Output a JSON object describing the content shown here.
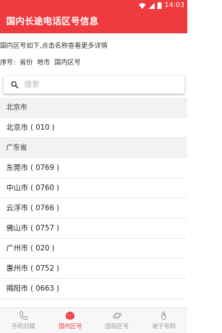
{
  "status": {
    "time": "14:03"
  },
  "appbar": {
    "title": "国内长途电话区号信息"
  },
  "intro": "国内区号如下,点击名称查看更多详情",
  "columns": [
    "序号:",
    "省份",
    "地市",
    "国内区号"
  ],
  "search": {
    "placeholder": "搜索"
  },
  "list": [
    {
      "type": "section",
      "label": "北京市"
    },
    {
      "type": "row",
      "label": "北京市 ( 010 )"
    },
    {
      "type": "section",
      "label": "广东省"
    },
    {
      "type": "row",
      "label": "东莞市 ( 0769 )"
    },
    {
      "type": "row",
      "label": "中山市 ( 0760 )"
    },
    {
      "type": "row",
      "label": "云浮市 ( 0766 )"
    },
    {
      "type": "row",
      "label": "佛山市 ( 0757 )"
    },
    {
      "type": "row",
      "label": "广州市 ( 020 )"
    },
    {
      "type": "row",
      "label": "惠州市 ( 0752 )"
    },
    {
      "type": "row",
      "label": "揭阳市 ( 0663 )"
    }
  ],
  "bottom_nav": [
    {
      "label": "手机归属",
      "icon": "phone-icon",
      "active": false
    },
    {
      "label": "国内区号",
      "icon": "cube-icon",
      "active": true
    },
    {
      "label": "国际区号",
      "icon": "planet-icon",
      "active": false
    },
    {
      "label": "谢子号码",
      "icon": "flame-icon",
      "active": false
    }
  ],
  "colors": {
    "primary": "#ef3b3f",
    "section_bg": "#f2f2f2",
    "nav_inactive": "#9a9a9a"
  }
}
